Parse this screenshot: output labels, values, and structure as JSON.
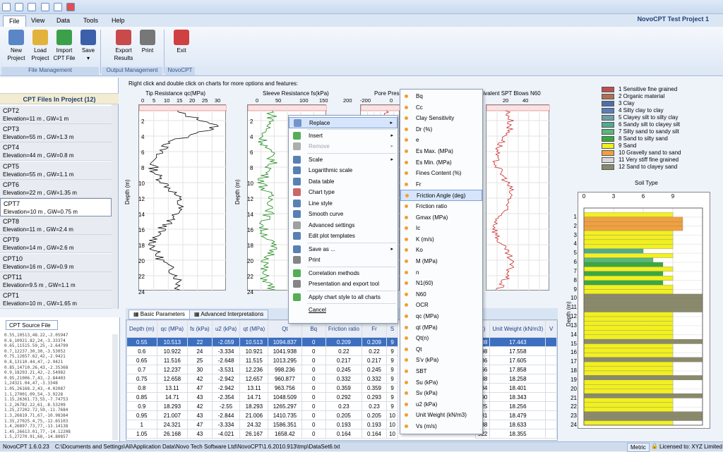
{
  "app": {
    "project_title": "NovoCPT Test Project 1",
    "status_version": "NovoCPT 1.6.0.23",
    "status_path": "C:\\Documents and Settings\\Ali\\Application Data\\Novo Tech Software Ltd\\NovoCPT\\1.6.2010.913\\tmp\\DataSet6.txt",
    "status_units": "Metric",
    "status_license": "Licensed to: XYZ Limited"
  },
  "menu": [
    "File",
    "View",
    "Data",
    "Tools",
    "Help"
  ],
  "ribbon": {
    "buttons": [
      {
        "label1": "New",
        "label2": "Project",
        "icon": "new-project-icon",
        "color": "#5a86c8"
      },
      {
        "label1": "Load",
        "label2": "Project",
        "icon": "folder-icon",
        "color": "#e2b33a"
      },
      {
        "label1": "Import",
        "label2": "CPT File",
        "icon": "import-arrow-icon",
        "color": "#3aa04a"
      },
      {
        "label1": "Save",
        "label2": "▾",
        "icon": "save-icon",
        "color": "#3b5fa8"
      },
      {
        "label1": "Export",
        "label2": "Results",
        "icon": "export-icon",
        "color": "#c94a4a"
      },
      {
        "label1": "Print",
        "label2": "",
        "icon": "printer-icon",
        "color": "#777777"
      },
      {
        "label1": "Exit",
        "label2": "",
        "icon": "exit-icon",
        "color": "#d04040"
      }
    ],
    "groups": [
      "File Management",
      "Output Management",
      "NovoCPT"
    ]
  },
  "cpt_panel": {
    "header": "CPT Files In Project (12)",
    "items": [
      {
        "name": "CPT2",
        "detail": "Elevation=11 m , GW=1 m"
      },
      {
        "name": "CPT3",
        "detail": "Elevation=55 m , GW=1.3 m"
      },
      {
        "name": "CPT4",
        "detail": "Elevation=44 m , GW=0.8 m"
      },
      {
        "name": "CPT5",
        "detail": "Elevation=55 m , GW=1.1 m"
      },
      {
        "name": "CPT6",
        "detail": "Elevation=22 m , GW=1.35 m"
      },
      {
        "name": "CPT7",
        "detail": "Elevation=10 m , GW=0.75 m"
      },
      {
        "name": "CPT8",
        "detail": "Elevation=11 m , GW=2.4 m"
      },
      {
        "name": "CPT9",
        "detail": "Elevation=14 m , GW=2.6 m"
      },
      {
        "name": "CPT10",
        "detail": "Elevation=16 m , GW=0.9 m"
      },
      {
        "name": "CPT11",
        "detail": "Elevation=9.5 m , GW=1.1 m"
      },
      {
        "name": "CPT1",
        "detail": "Elevation=10 m , GW=1.65 m"
      }
    ]
  },
  "source_panel": {
    "tab": "CPT Source File",
    "lines": [
      "0.55,10513,48.22,-2.05947",
      "0.6,10921.82,24,-3.33374",
      "0.65,11515.59,25,-2.64799",
      "0.7,12237.30,30,-3.53052",
      "0.75,12657.62,42,-2.9421",
      "0.8,13110.44,47,-2.9421",
      "0.85,14710.26,43,-2.35368",
      "0.9,18293.21,42,-2.54982",
      "0.95,21006.7,43,-2.84403",
      "1,24321.04,47,-3.3348",
      "1.05,26168.2,43,-4.02087",
      "1.1,27001.09,54,-3.9228",
      "1.15,26361.73,55,-7.74753",
      "1.2,26782.22,61,-8.53209",
      "1.25,27202.72,59,-11.7684",
      "1.3,26819.71,67,-10.98384",
      "1.35,27025.4,75,-12.65103",
      "1.4,26897.73,77,-13.14138",
      "1.45,26613.01,77,-14.12208",
      "1.5,27270.91,68,-14.80857"
    ]
  },
  "charts": {
    "hint": "Right click and double click on charts for more options and features:",
    "ylabel": "Depth (m)",
    "y_ticks": [
      "2",
      "4",
      "6",
      "8",
      "10",
      "12",
      "14",
      "16",
      "18",
      "20",
      "22",
      "24"
    ],
    "plots": [
      {
        "title": "Tip Resistance qc(MPa)",
        "ticks": [
          "0",
          "5",
          "10",
          "15",
          "20",
          "25",
          "30"
        ]
      },
      {
        "title": "Sleeve Resistance fs(kPa)",
        "ticks": [
          "0",
          "50",
          "100",
          "150",
          "200"
        ]
      },
      {
        "title": "Pore Pres",
        "ticks": [
          "-200",
          "0"
        ]
      },
      {
        "title": "uivalent SPT Blows N60",
        "ticks": [
          "20",
          "40"
        ]
      }
    ]
  },
  "context_menu": {
    "items": [
      {
        "label": "Replace",
        "icon": "replace-icon",
        "arrow": "▸",
        "hl": true
      },
      {
        "label": "Insert",
        "icon": "insert-plus-icon",
        "arrow": "▸"
      },
      {
        "label": "Remove",
        "icon": "remove-minus-icon",
        "arrow": "▸",
        "dis": true
      },
      {
        "label": "Scale",
        "icon": "scale-icon",
        "arrow": "▸"
      },
      {
        "label": "Logarithmic scale",
        "icon": "log-scale-icon"
      },
      {
        "label": "Data table",
        "icon": "data-table-icon"
      },
      {
        "label": "Chart type",
        "icon": "chart-type-icon"
      },
      {
        "label": "Line style",
        "icon": "line-style-icon"
      },
      {
        "label": "Smooth curve",
        "icon": "smooth-curve-icon"
      },
      {
        "label": "Advanced settings",
        "icon": "settings-gear-icon"
      },
      {
        "label": "Edit plot templates",
        "icon": "plot-template-icon"
      },
      {
        "label": "Save as ...",
        "icon": "save-as-icon",
        "arrow": "▸"
      },
      {
        "label": "Print",
        "icon": "print-icon"
      },
      {
        "label": "Correlation methods",
        "icon": "correlation-icon"
      },
      {
        "label": "Presentation and export tool",
        "icon": "export-tool-icon"
      },
      {
        "label": "Apply chart style to all charts",
        "icon": "checkmark-icon"
      },
      {
        "label": "Cancel",
        "icon": "",
        "underline": true
      }
    ]
  },
  "submenu": {
    "items": [
      "Bq",
      "Cc",
      "Clay Sensitivity",
      "Dr (%)",
      "e",
      "Es Max. (MPa)",
      "Es Min. (MPa)",
      "Fines Content (%)",
      "Fr",
      "Friction Angle (deg)",
      "Friction ratio",
      "Gmax (MPa)",
      "Ic",
      "K (m/s)",
      "Ko",
      "M (MPa)",
      "n",
      "N1(60)",
      "N60",
      "OCR",
      "qc (MPa)",
      "qt (MPa)",
      "Qt(n)",
      "Qt",
      "S'v (kPa)",
      "SBT",
      "Su (kPa)",
      "Sv (kPa)",
      "u2 (kPa)",
      "Unit Weight (kN/m3)",
      "Vs (m/s)"
    ],
    "highlight_index": 9
  },
  "grid": {
    "tabs": [
      "Basic Parameters",
      "Advanced Interpretations"
    ],
    "headers": [
      "Depth (m)",
      "qc (MPa)",
      "fs (kPa)",
      "u2 (kPa)",
      "qt (MPa)",
      "Qt",
      "Bq",
      "Friction ratio",
      "Fr",
      "S"
    ],
    "headers_right": [
      "n)",
      "Unit Weight (kN/m3)",
      "V"
    ],
    "rows": [
      [
        "0.55",
        "10.513",
        "22",
        "-2.059",
        "10.513",
        "1094.837",
        "0",
        "0.209",
        "0.209",
        "9",
        "508",
        "17.443"
      ],
      [
        "0.6",
        "10.922",
        "24",
        "-3.334",
        "10.921",
        "1041.938",
        "0",
        "0.22",
        "0.22",
        "9",
        "198",
        "17.558"
      ],
      [
        "0.65",
        "11.516",
        "25",
        "-2.648",
        "11.515",
        "1013.295",
        "0",
        "0.217",
        "0.217",
        "9",
        "686",
        "17.605"
      ],
      [
        "0.7",
        "12.237",
        "30",
        "-3.531",
        "12.236",
        "998.236",
        "0",
        "0.245",
        "0.245",
        "9",
        "866",
        "17.858"
      ],
      [
        "0.75",
        "12.658",
        "42",
        "-2.942",
        "12.657",
        "960.877",
        "0",
        "0.332",
        "0.332",
        "9",
        "288",
        "18.258"
      ],
      [
        "0.8",
        "13.11",
        "47",
        "-2.942",
        "13.11",
        "963.756",
        "0",
        "0.359",
        "0.359",
        "9",
        "434",
        "18.401"
      ],
      [
        "0.85",
        "14.71",
        "43",
        "-2.354",
        "14.71",
        "1048.509",
        "0",
        "0.292",
        "0.293",
        "9",
        "890",
        "18.343"
      ],
      [
        "0.9",
        "18.293",
        "42",
        "-2.55",
        "18.293",
        "1265.297",
        "0",
        "0.23",
        "0.23",
        "9",
        "425",
        "18.256"
      ],
      [
        "0.95",
        "21.007",
        "43",
        "-2.844",
        "21.006",
        "1410.735",
        "0",
        "0.205",
        "0.205",
        "10",
        "181",
        "18.479"
      ],
      [
        "1",
        "24.321",
        "47",
        "-3.334",
        "24.32",
        "1586.351",
        "0",
        "0.193",
        "0.193",
        "10",
        "638",
        "18.633"
      ],
      [
        "1.05",
        "26.168",
        "43",
        "-4.021",
        "26.167",
        "1658.42",
        "0",
        "0.164",
        "0.164",
        "10",
        "922",
        "18.355"
      ]
    ]
  },
  "legend": {
    "items": [
      {
        "label": "1 Sensitive fine grained",
        "color": "#c0504d"
      },
      {
        "label": "2 Organic material",
        "color": "#b07050"
      },
      {
        "label": "3 Clay",
        "color": "#4f6fa8"
      },
      {
        "label": "4 Silty clay to clay",
        "color": "#5a7fb8"
      },
      {
        "label": "5 Clayey silt to silty clay",
        "color": "#6aa0a8"
      },
      {
        "label": "6 Sandy silt to clayey silt",
        "color": "#4faa90"
      },
      {
        "label": "7 Silty sand to sandy silt",
        "color": "#58b878"
      },
      {
        "label": "8 Sand to silty sand",
        "color": "#3aa840"
      },
      {
        "label": "9 Sand",
        "color": "#f2f020"
      },
      {
        "label": "10 Gravelly sand to sand",
        "color": "#f0a040"
      },
      {
        "label": "11 Very stiff fine grained",
        "color": "#d8d8d8"
      },
      {
        "label": "12 Sand to clayey sand",
        "color": "#8a8a6a"
      }
    ]
  },
  "soil_chart": {
    "title": "Soil Type",
    "x_ticks": [
      "0",
      "3",
      "6",
      "9"
    ],
    "y_ticks": [
      "1",
      "2",
      "3",
      "4",
      "5",
      "6",
      "7",
      "8",
      "9",
      "10",
      "11",
      "12",
      "13",
      "14",
      "15",
      "16",
      "17",
      "18",
      "19",
      "20",
      "21",
      "22",
      "23",
      "24"
    ],
    "ylabel": "Depth (m)"
  },
  "chart_data": {
    "type": "bar",
    "title": "Soil Type",
    "xlabel": "",
    "ylabel": "Depth (m)",
    "xlim": [
      0,
      12
    ],
    "ylim": [
      24,
      0
    ],
    "depths": [
      1,
      1.5,
      2,
      2.5,
      3,
      3.5,
      4,
      4.5,
      5,
      5.5,
      6,
      6.5,
      7,
      7.5,
      8,
      8.5,
      9,
      9.5,
      10,
      10.5,
      11,
      11.5,
      12,
      12.5,
      13,
      13.5,
      14,
      14.5,
      15,
      15.5,
      16,
      16.5,
      17,
      17.5,
      18,
      18.5,
      19,
      19.5,
      20,
      20.5,
      21,
      21.5,
      22,
      22.5,
      23,
      23.5,
      24
    ],
    "values": [
      9,
      10,
      10,
      10,
      9,
      9,
      9,
      9,
      6,
      9,
      7,
      8,
      9,
      8,
      9,
      8,
      9,
      9,
      12,
      12,
      12,
      12,
      9,
      9,
      9,
      9,
      9,
      9,
      12,
      9,
      9,
      9,
      12,
      9,
      9,
      9,
      12,
      9,
      9,
      9,
      12,
      9,
      9,
      9,
      12,
      12,
      9
    ],
    "legend_position": "top-right"
  }
}
